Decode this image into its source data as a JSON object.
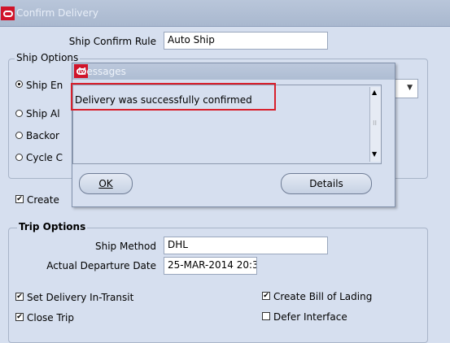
{
  "window": {
    "title": "Confirm Delivery"
  },
  "ship_confirm_rule": {
    "label": "Ship Confirm Rule",
    "value": "Auto Ship"
  },
  "ship_options": {
    "title": "Ship Options",
    "radios": [
      {
        "label": "Ship En",
        "mnemonic": "S",
        "selected": true
      },
      {
        "label": "Ship Al",
        "mnemonic": "S",
        "selected": false
      },
      {
        "label": "Backor",
        "mnemonic": "B",
        "selected": false
      },
      {
        "label": "Cycle C",
        "mnemonic": "C",
        "selected": false
      }
    ]
  },
  "create_checkbox": {
    "label": "Create",
    "checked": true
  },
  "trip_options": {
    "title": "Trip Options",
    "ship_method": {
      "label": "Ship Method",
      "value": "DHL"
    },
    "departure_date": {
      "label": "Actual Departure Date",
      "value": "25-MAR-2014 20:3"
    },
    "set_in_transit": {
      "label": "Set Delivery In-Transit",
      "checked": true
    },
    "create_bol": {
      "label": "Create Bill of Lading",
      "checked": true
    },
    "close_trip": {
      "label": "Close Trip",
      "checked": true
    },
    "defer_interface": {
      "label": "Defer Interface",
      "checked": false
    }
  },
  "dialog": {
    "title": "Messages",
    "message": "Delivery was successfully confirmed",
    "ok_label": "OK",
    "details_label": "Details"
  },
  "colors": {
    "highlight": "#d8202c",
    "logo": "#d0142a"
  }
}
